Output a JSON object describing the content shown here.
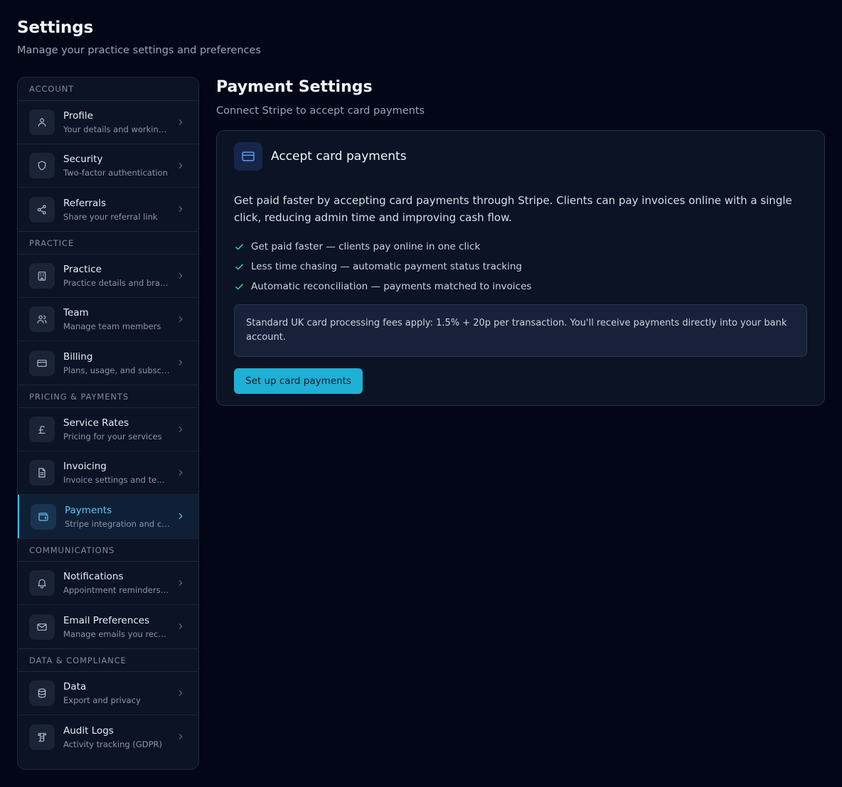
{
  "header": {
    "title": "Settings",
    "subtitle": "Manage your practice settings and preferences"
  },
  "colors": {
    "accent": "#38bdf8",
    "button": "#1eb0d5",
    "check": "#34d399",
    "background": "#030617"
  },
  "sidebar": {
    "sections": [
      {
        "title": "ACCOUNT",
        "items": [
          {
            "label": "Profile",
            "desc": "Your details and working hours",
            "icon": "user-icon"
          },
          {
            "label": "Security",
            "desc": "Two-factor authentication",
            "icon": "shield-icon"
          },
          {
            "label": "Referrals",
            "desc": "Share your referral link",
            "icon": "share-icon"
          }
        ]
      },
      {
        "title": "PRACTICE",
        "items": [
          {
            "label": "Practice",
            "desc": "Practice details and branding",
            "icon": "building-icon"
          },
          {
            "label": "Team",
            "desc": "Manage team members",
            "icon": "users-icon"
          },
          {
            "label": "Billing",
            "desc": "Plans, usage, and subscriptions",
            "icon": "credit-card-icon"
          }
        ]
      },
      {
        "title": "PRICING & PAYMENTS",
        "items": [
          {
            "label": "Service Rates",
            "desc": "Pricing for your services",
            "icon": "pound-icon"
          },
          {
            "label": "Invoicing",
            "desc": "Invoice settings and templates",
            "icon": "document-icon"
          },
          {
            "label": "Payments",
            "desc": "Stripe integration and card payments",
            "icon": "wallet-icon",
            "active": true
          }
        ]
      },
      {
        "title": "COMMUNICATIONS",
        "items": [
          {
            "label": "Notifications",
            "desc": "Appointment reminders and alerts",
            "icon": "bell-icon"
          },
          {
            "label": "Email Preferences",
            "desc": "Manage emails you receive",
            "icon": "mail-icon"
          }
        ]
      },
      {
        "title": "DATA & COMPLIANCE",
        "items": [
          {
            "label": "Data",
            "desc": "Export and privacy",
            "icon": "database-icon"
          },
          {
            "label": "Audit Logs",
            "desc": "Activity tracking (GDPR)",
            "icon": "scroll-icon"
          }
        ]
      }
    ]
  },
  "main": {
    "title": "Payment Settings",
    "subtitle": "Connect Stripe to accept card payments",
    "card": {
      "icon": "credit-card-icon",
      "title": "Accept card payments",
      "description": "Get paid faster by accepting card payments through Stripe. Clients can pay invoices online with a single click, reducing admin time and improving cash flow.",
      "benefits": [
        "Get paid faster — clients pay online in one click",
        "Less time chasing — automatic payment status tracking",
        "Automatic reconciliation — payments matched to invoices"
      ],
      "fee_note": "Standard UK card processing fees apply: 1.5% + 20p per transaction. You'll receive payments directly into your bank account.",
      "button_label": "Set up card payments"
    }
  }
}
